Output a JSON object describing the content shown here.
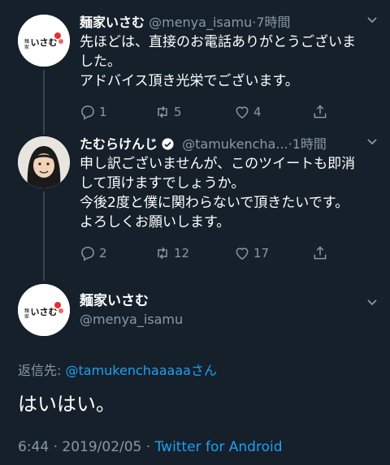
{
  "colors": {
    "background": "#15202b",
    "secondary_text": "#8899a6",
    "link": "#1da1f2",
    "verified": "#ffffff"
  },
  "tweet1": {
    "name": "麺家いさむ",
    "handle": "@menya_isamu",
    "dot": "·",
    "time": "7時間",
    "text_lines": [
      "先ほどは、直接のお電話ありがとうございま",
      "した。",
      "アドバイス頂き光栄でございます。"
    ],
    "avatar_text": "麺家いさむ",
    "replies": "1",
    "retweets": "5",
    "likes": "4"
  },
  "tweet2": {
    "name": "たむらけんじ",
    "handle": "@tamukencha...",
    "dot": "·",
    "time": "1時間",
    "text_lines": [
      "申し訳ございませんが、このツイートも即消",
      "して頂けますでしょうか。",
      "今後2度と僕に関わらないで頂きたいです。",
      "よろしくお願いします。"
    ],
    "replies": "2",
    "retweets": "12",
    "likes": "17"
  },
  "tweet3": {
    "name": "麺家いさむ",
    "handle": "@menya_isamu",
    "avatar_text": "麺家いさむ",
    "replying_prefix": "返信先: ",
    "replying_to": "@tamukenchaaaaa",
    "replying_suffix": "さん",
    "text": "はいはい。",
    "timestamp": "6:44 · 2019/02/05 · ",
    "source": "Twitter for Android"
  }
}
